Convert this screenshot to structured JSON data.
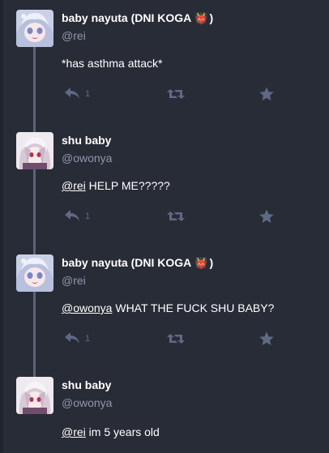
{
  "statuses": [
    {
      "avatar": "avatar-nayuta-anime",
      "display_name": "baby nayuta (DNI KOGA",
      "display_emoji": "👹",
      "display_suffix": ")",
      "handle": "@rei",
      "mention": "",
      "text": "*has asthma attack*",
      "reply_count": "1"
    },
    {
      "avatar": "avatar-shu-anime",
      "display_name": "shu baby",
      "handle": "@owonya",
      "mention": "@rei",
      "text": " HELP ME?????",
      "reply_count": "1"
    },
    {
      "avatar": "avatar-nayuta-anime",
      "display_name": "baby nayuta (DNI KOGA",
      "display_emoji": "👹",
      "display_suffix": ")",
      "handle": "@rei",
      "mention": "@owonya",
      "text": " WHAT THE FUCK SHU BABY?",
      "reply_count": "1"
    },
    {
      "avatar": "avatar-shu-anime",
      "display_name": "shu baby",
      "handle": "@owonya",
      "mention": "@rei",
      "text": " im 5 years old"
    }
  ],
  "icons": {
    "reply": "reply-icon",
    "boost": "boost-icon",
    "favourite": "star-icon"
  },
  "colors": {
    "background": "#282c37",
    "thread_line": "#5c6377",
    "icon": "#606984",
    "handle": "#8f97ab"
  }
}
